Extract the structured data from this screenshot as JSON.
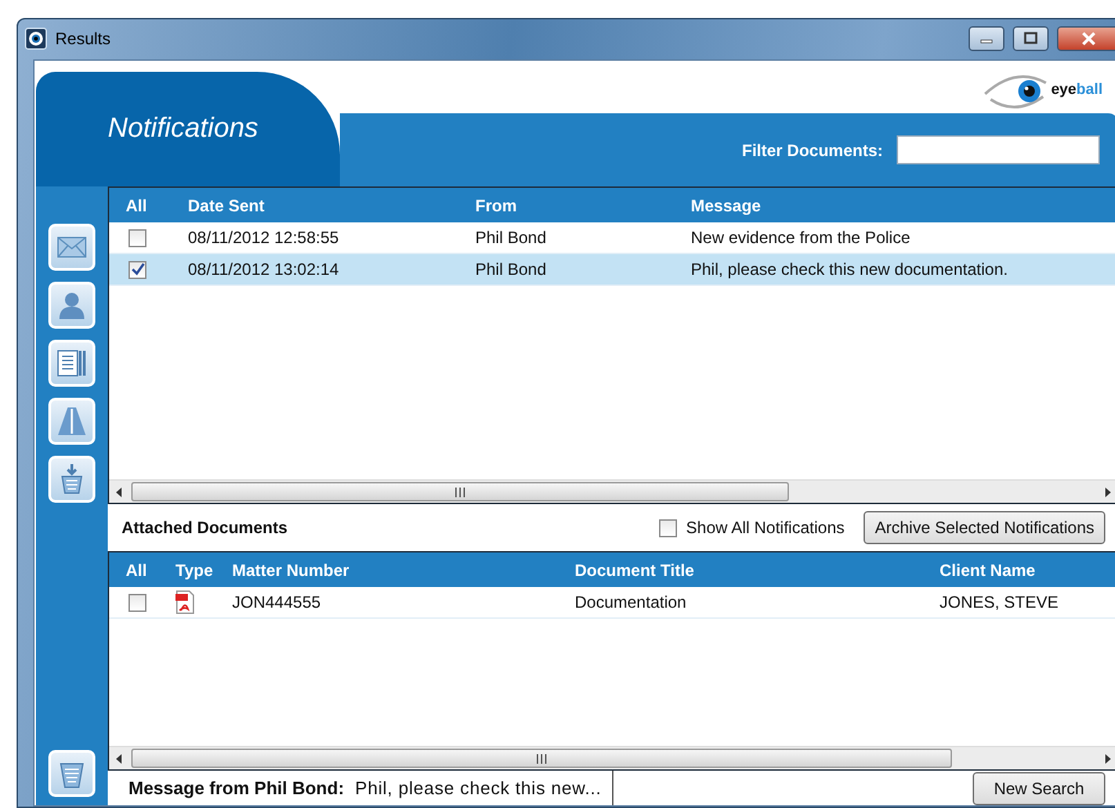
{
  "window": {
    "title": "Results"
  },
  "header": {
    "title": "Notifications",
    "logo": "**eye**ball",
    "filter_label": "Filter Documents:"
  },
  "sidebar": {
    "buttons": [
      {
        "kind": "mail"
      },
      {
        "kind": "person"
      },
      {
        "kind": "documents"
      },
      {
        "kind": "road"
      },
      {
        "kind": "download"
      }
    ],
    "bottom_button": {
      "kind": "bin"
    }
  },
  "notifications": {
    "columns": [
      "All",
      "Date Sent",
      "From",
      "Message"
    ],
    "rows": [
      {
        "checked": false,
        "selected": false,
        "date_sent": "08/11/2012 12:58:55",
        "from": "Phil Bond",
        "message": "New evidence from the Police"
      },
      {
        "checked": true,
        "selected": true,
        "date_sent": "08/11/2012 13:02:14",
        "from": "Phil Bond",
        "message": "Phil, please check this new documentation."
      }
    ]
  },
  "attached": {
    "title": "Attached Documents",
    "show_all": {
      "label": "Show All Notifications",
      "checked": false
    },
    "archive_button": "Archive Selected Notifications",
    "columns": [
      "All",
      "Type",
      "Matter Number",
      "Document Title",
      "Client Name"
    ],
    "rows": [
      {
        "checked": false,
        "kind": "pdf",
        "matter_number": "JON444555",
        "document_title": "Documentation",
        "client_name": "JONES, STEVE"
      }
    ]
  },
  "status": {
    "label": "Message from Phil Bond:",
    "message": "Phil, please check this new...",
    "button": "New Search"
  }
}
